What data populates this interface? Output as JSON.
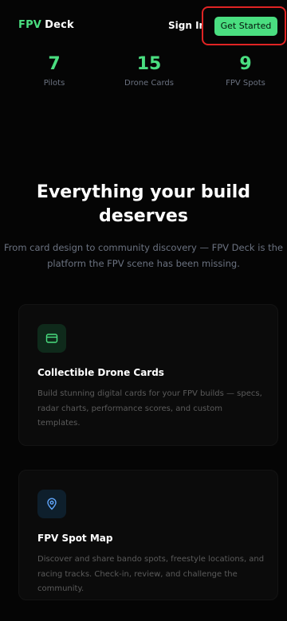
{
  "header": {
    "logo_accent": "FPV",
    "logo_rest": "Deck",
    "sign_in": "Sign In",
    "get_started": "Get Started"
  },
  "stats": [
    {
      "value": "7",
      "label": "Pilots"
    },
    {
      "value": "15",
      "label": "Drone Cards"
    },
    {
      "value": "9",
      "label": "FPV Spots"
    }
  ],
  "hero": {
    "title": "Everything your build deserves",
    "subtitle": "From card design to community discovery — FPV Deck is the platform the FPV scene has been missing."
  },
  "features": [
    {
      "icon": "card-icon",
      "title": "Collectible Drone Cards",
      "description": "Build stunning digital cards for your FPV builds — specs, radar charts, performance scores, and custom templates."
    },
    {
      "icon": "map-pin-icon",
      "title": "FPV Spot Map",
      "description": "Discover and share bando spots, freestyle locations, and racing tracks. Check-in, review, and challenge the community."
    }
  ],
  "colors": {
    "accent": "#4ade80",
    "background": "#050505",
    "highlight_outline": "#e02424",
    "icon_blue": "#60a5fa"
  }
}
